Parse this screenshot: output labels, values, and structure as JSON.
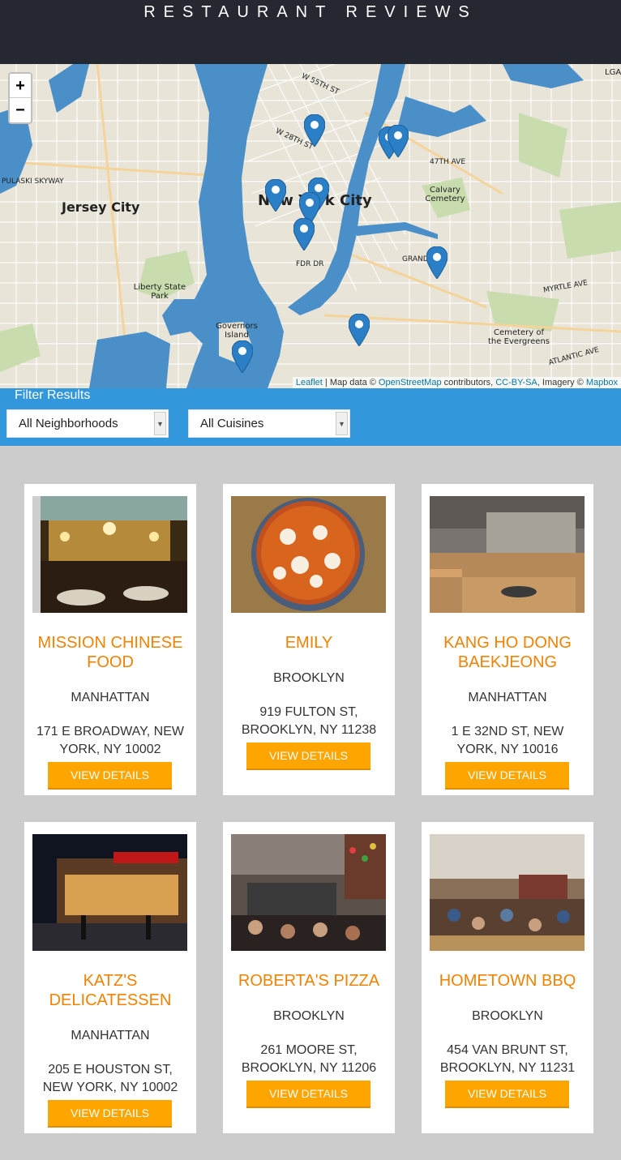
{
  "header": {
    "title": "RESTAURANT REVIEWS"
  },
  "map": {
    "zoom_in": "+",
    "zoom_out": "−",
    "labels": {
      "city_ny": "New York City",
      "city_jc": "Jersey City",
      "liberty": "Liberty State Park",
      "governors": "Governors Island",
      "calvary": "Calvary Cemetery",
      "evergreens": "Cemetery of the Evergreens",
      "pulaski": "PULASKI SKYWAY",
      "fdr": "FDR DR",
      "w55": "W 55TH ST",
      "w28": "W 28TH ST",
      "st47": "47TH AVE",
      "grand": "GRAND ST",
      "myrtle": "MYRTLE AVE",
      "atlantic": "ATLANTIC AVE",
      "lga": "LGA"
    },
    "attribution": {
      "leaflet": "Leaflet",
      "mid": " | Map data © ",
      "osm": "OpenStreetMap",
      "contrib": " contributors, ",
      "ccbysa": "CC-BY-SA",
      "imagery": ", Imagery © ",
      "mapbox": "Mapbox"
    }
  },
  "filter": {
    "title": "Filter Results",
    "neighborhood": "All Neighborhoods",
    "cuisine": "All Cuisines"
  },
  "restaurants": [
    {
      "name": "MISSION CHINESE FOOD",
      "neighborhood": "MANHATTAN",
      "address": "171 E BROADWAY, NEW YORK, NY 10002",
      "button": "VIEW DETAILS"
    },
    {
      "name": "EMILY",
      "neighborhood": "BROOKLYN",
      "address": "919 FULTON ST, BROOKLYN, NY 11238",
      "button": "VIEW DETAILS"
    },
    {
      "name": "KANG HO DONG BAEKJEONG",
      "neighborhood": "MANHATTAN",
      "address": "1 E 32ND ST, NEW YORK, NY 10016",
      "button": "VIEW DETAILS"
    },
    {
      "name": "KATZ'S DELICATESSEN",
      "neighborhood": "MANHATTAN",
      "address": "205 E HOUSTON ST, NEW YORK, NY 10002",
      "button": "VIEW DETAILS"
    },
    {
      "name": "ROBERTA'S PIZZA",
      "neighborhood": "BROOKLYN",
      "address": "261 MOORE ST, BROOKLYN, NY 11206",
      "button": "VIEW DETAILS"
    },
    {
      "name": "HOMETOWN BBQ",
      "neighborhood": "BROOKLYN",
      "address": "454 VAN BRUNT ST, BROOKLYN, NY 11231",
      "button": "VIEW DETAILS"
    }
  ],
  "colors": {
    "header_bg": "#252831",
    "filter_bg": "#3397db",
    "accent": "#f18200",
    "button": "#ffa500",
    "water": "#4b8fc8",
    "marker": "#2a7fc6"
  }
}
